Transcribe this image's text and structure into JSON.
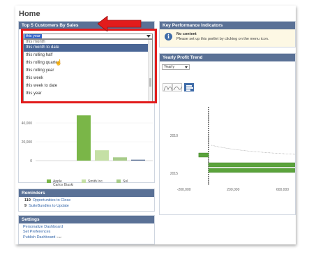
{
  "page": {
    "title": "Home"
  },
  "top5": {
    "header": "Top 5 Customers By Sales",
    "selected": "this year",
    "options_first": "this month",
    "options": [
      "this month to date",
      "this rolling half",
      "this rolling quarter",
      "this rolling year",
      "this week",
      "this week to date",
      "this year"
    ],
    "highlighted_index": 0,
    "chart_data": {
      "type": "bar",
      "categories": [
        "Apple",
        "Smith Inc.",
        "Sol",
        ""
      ],
      "values": [
        48000,
        11000,
        3500,
        1000
      ],
      "yticks": [
        "40,000",
        "20,000",
        "0"
      ],
      "legend": [
        "Apple",
        "Smith Inc.",
        "Sol",
        "Carlos Biaski"
      ],
      "colors": [
        "#7ab648",
        "#c5e0a5",
        "#a8cc8a",
        "#5a7196"
      ]
    }
  },
  "reminders": {
    "header": "Reminders",
    "items": [
      {
        "count": "119",
        "label": "Opportunities to Close"
      },
      {
        "count": "9",
        "label": "SuiteBundles to Update"
      }
    ]
  },
  "settings": {
    "header": "Settings",
    "links": [
      "Personalize Dashboard",
      "Set Preferences",
      "Publish Dashboard"
    ],
    "publish_tag": "List"
  },
  "kpi": {
    "header": "Key Performance Indicators",
    "title": "No content",
    "message": "Please set up this portlet by clicking on the menu icon."
  },
  "yearly": {
    "header": "Yearly Profit Trend",
    "select_value": "Yearly",
    "chart_data": {
      "type": "bar",
      "orientation": "horizontal",
      "categories": [
        "2010",
        "2015"
      ],
      "xticks": [
        "-200,000",
        "200,000",
        "600,000"
      ],
      "series": [
        {
          "values": [
            -80000,
            0
          ]
        },
        {
          "values": [
            0,
            700000
          ]
        },
        {
          "values": [
            0,
            700000
          ]
        }
      ]
    }
  },
  "colors": {
    "header_bg": "#5a7196",
    "accent_red": "#e21c1c",
    "bar_green": "#7ab648"
  }
}
